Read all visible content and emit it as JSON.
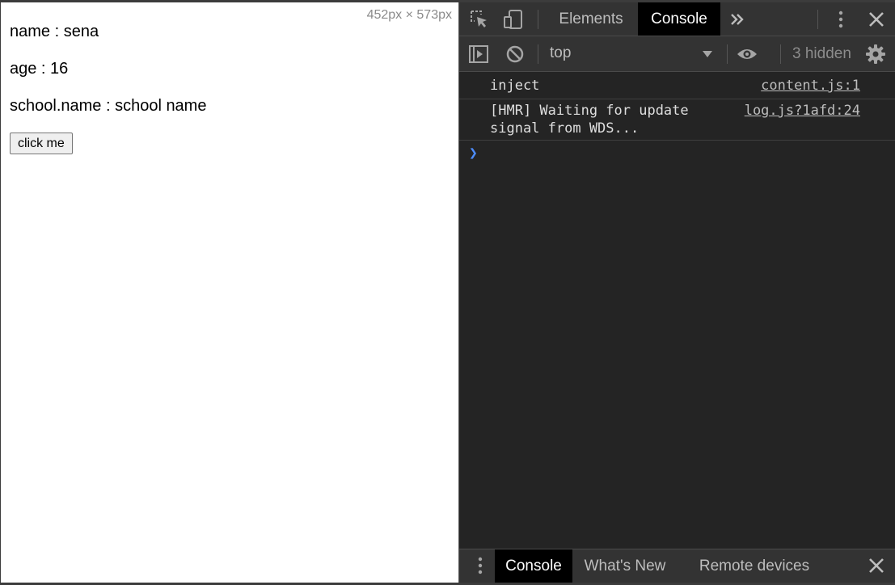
{
  "page": {
    "viewport_size": "452px × 573px",
    "lines": [
      "name : sena",
      "age : 16",
      "school.name : school name"
    ],
    "button_label": "click me"
  },
  "devtools": {
    "tabs": [
      "Elements",
      "Console"
    ],
    "active_tab": "Console",
    "more_tabs_icon": "chevron-double-right-icon",
    "context": "top",
    "hidden_label": "3 hidden",
    "messages": [
      {
        "text": "inject",
        "source": "content.js:1"
      },
      {
        "text": "[HMR] Waiting for update\nsignal from WDS...",
        "source": "log.js?1afd:24"
      }
    ],
    "drawer_tabs": [
      "Console",
      "What's New",
      "Remote devices"
    ],
    "drawer_active": "Console",
    "colors": {
      "panel": "#242424",
      "toolbar": "#333333",
      "prompt": "#4d8dff"
    }
  }
}
